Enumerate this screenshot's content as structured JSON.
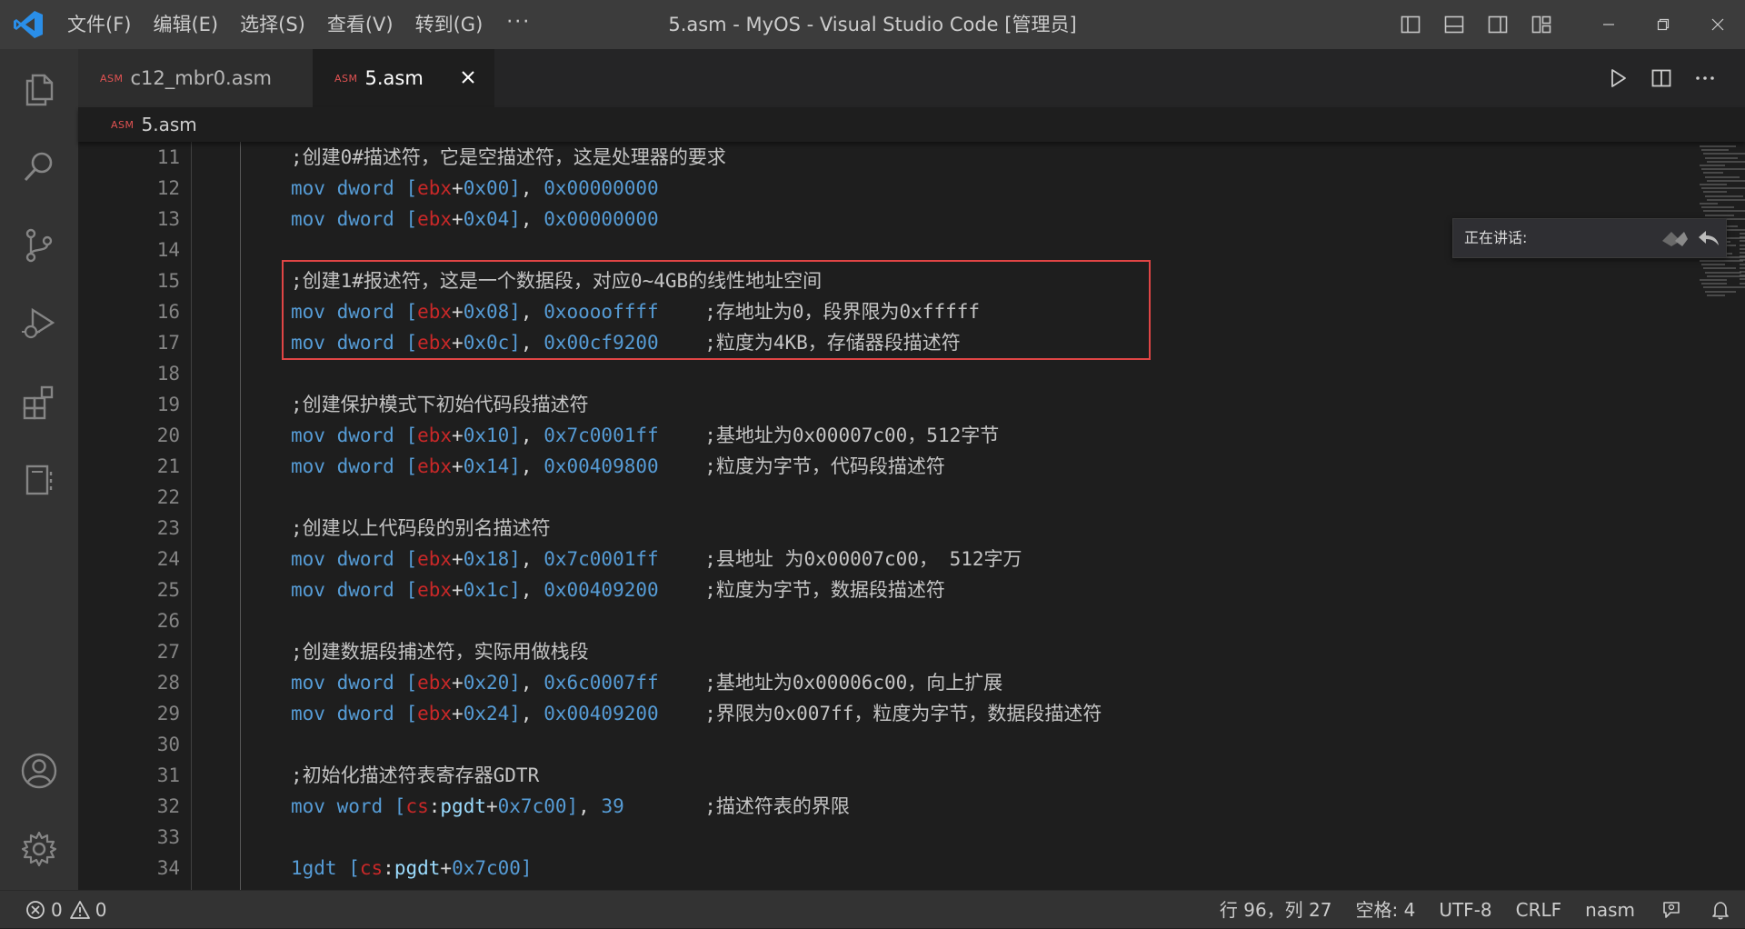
{
  "titlebar": {
    "menus": [
      "文件(F)",
      "编辑(E)",
      "选择(S)",
      "查看(V)",
      "转到(G)"
    ],
    "more": "···",
    "window_title": "5.asm - MyOS - Visual Studio Code [管理员]"
  },
  "tabs": [
    {
      "badge": "ASM",
      "label": "c12_mbr0.asm",
      "active": false
    },
    {
      "badge": "ASM",
      "label": "5.asm",
      "active": true
    }
  ],
  "breadcrumb": {
    "badge": "ASM",
    "label": "5.asm"
  },
  "speaking": {
    "label": "正在讲话:"
  },
  "editor": {
    "lines": [
      {
        "n": "11",
        "tokens": [
          [
            "cmt",
            ";创建0#描述符，它是空描述符，这是处理器的要求"
          ]
        ]
      },
      {
        "n": "12",
        "tokens": [
          [
            "kw",
            "mov dword "
          ],
          [
            "br",
            "["
          ],
          [
            "reg",
            "ebx"
          ],
          [
            "op",
            "+"
          ],
          [
            "num",
            "0x00"
          ],
          [
            "br",
            "]"
          ],
          [
            "op",
            ", "
          ],
          [
            "num",
            "0x00000000"
          ]
        ]
      },
      {
        "n": "13",
        "tokens": [
          [
            "kw",
            "mov dword "
          ],
          [
            "br",
            "["
          ],
          [
            "reg",
            "ebx"
          ],
          [
            "op",
            "+"
          ],
          [
            "num",
            "0x04"
          ],
          [
            "br",
            "]"
          ],
          [
            "op",
            ", "
          ],
          [
            "num",
            "0x00000000"
          ]
        ]
      },
      {
        "n": "14",
        "tokens": []
      },
      {
        "n": "15",
        "tokens": [
          [
            "cmt",
            ";创建1#报述符，这是一个数据段，对应0~4GB的线性地址空间"
          ]
        ]
      },
      {
        "n": "16",
        "tokens": [
          [
            "kw",
            "mov dword "
          ],
          [
            "br",
            "["
          ],
          [
            "reg",
            "ebx"
          ],
          [
            "op",
            "+"
          ],
          [
            "num",
            "0x08"
          ],
          [
            "br",
            "]"
          ],
          [
            "op",
            ", "
          ],
          [
            "num",
            "0xooooffff"
          ],
          [
            "op",
            "    "
          ],
          [
            "cmt",
            ";存地址为0，段界限为0xfffff"
          ]
        ]
      },
      {
        "n": "17",
        "tokens": [
          [
            "kw",
            "mov dword "
          ],
          [
            "br",
            "["
          ],
          [
            "reg",
            "ebx"
          ],
          [
            "op",
            "+"
          ],
          [
            "num",
            "0x0c"
          ],
          [
            "br",
            "]"
          ],
          [
            "op",
            ", "
          ],
          [
            "num",
            "0x00cf9200"
          ],
          [
            "op",
            "    "
          ],
          [
            "cmt",
            ";粒度为4KB，存储器段描述符"
          ]
        ]
      },
      {
        "n": "18",
        "tokens": []
      },
      {
        "n": "19",
        "tokens": [
          [
            "cmt",
            ";创建保护模式下初始代码段描述符"
          ]
        ]
      },
      {
        "n": "20",
        "tokens": [
          [
            "kw",
            "mov dword "
          ],
          [
            "br",
            "["
          ],
          [
            "reg",
            "ebx"
          ],
          [
            "op",
            "+"
          ],
          [
            "num",
            "0x10"
          ],
          [
            "br",
            "]"
          ],
          [
            "op",
            ", "
          ],
          [
            "num",
            "0x7c0001ff"
          ],
          [
            "op",
            "    "
          ],
          [
            "cmt",
            ";基地址为0x00007c00，512字节"
          ]
        ]
      },
      {
        "n": "21",
        "tokens": [
          [
            "kw",
            "mov dword "
          ],
          [
            "br",
            "["
          ],
          [
            "reg",
            "ebx"
          ],
          [
            "op",
            "+"
          ],
          [
            "num",
            "0x14"
          ],
          [
            "br",
            "]"
          ],
          [
            "op",
            ", "
          ],
          [
            "num",
            "0x00409800"
          ],
          [
            "op",
            "    "
          ],
          [
            "cmt",
            ";粒度为字节，代码段描述符"
          ]
        ]
      },
      {
        "n": "22",
        "tokens": []
      },
      {
        "n": "23",
        "tokens": [
          [
            "cmt",
            ";创建以上代码段的别名描述符"
          ]
        ]
      },
      {
        "n": "24",
        "tokens": [
          [
            "kw",
            "mov dword "
          ],
          [
            "br",
            "["
          ],
          [
            "reg",
            "ebx"
          ],
          [
            "op",
            "+"
          ],
          [
            "num",
            "0x18"
          ],
          [
            "br",
            "]"
          ],
          [
            "op",
            ", "
          ],
          [
            "num",
            "0x7c0001ff"
          ],
          [
            "op",
            "    "
          ],
          [
            "cmt",
            ";县地址 为0x00007c00， 512字万"
          ]
        ]
      },
      {
        "n": "25",
        "tokens": [
          [
            "kw",
            "mov dword "
          ],
          [
            "br",
            "["
          ],
          [
            "reg",
            "ebx"
          ],
          [
            "op",
            "+"
          ],
          [
            "num",
            "0x1c"
          ],
          [
            "br",
            "]"
          ],
          [
            "op",
            ", "
          ],
          [
            "num",
            "0x00409200"
          ],
          [
            "op",
            "    "
          ],
          [
            "cmt",
            ";粒度为字节，数据段描述符"
          ]
        ]
      },
      {
        "n": "26",
        "tokens": []
      },
      {
        "n": "27",
        "tokens": [
          [
            "cmt",
            ";创建数据段捕述符，实际用做栈段"
          ]
        ]
      },
      {
        "n": "28",
        "tokens": [
          [
            "kw",
            "mov dword "
          ],
          [
            "br",
            "["
          ],
          [
            "reg",
            "ebx"
          ],
          [
            "op",
            "+"
          ],
          [
            "num",
            "0x20"
          ],
          [
            "br",
            "]"
          ],
          [
            "op",
            ", "
          ],
          [
            "num",
            "0x6c0007ff"
          ],
          [
            "op",
            "    "
          ],
          [
            "cmt",
            ";基地址为0x00006c00，向上扩展"
          ]
        ]
      },
      {
        "n": "29",
        "tokens": [
          [
            "kw",
            "mov dword "
          ],
          [
            "br",
            "["
          ],
          [
            "reg",
            "ebx"
          ],
          [
            "op",
            "+"
          ],
          [
            "num",
            "0x24"
          ],
          [
            "br",
            "]"
          ],
          [
            "op",
            ", "
          ],
          [
            "num",
            "0x00409200"
          ],
          [
            "op",
            "    "
          ],
          [
            "cmt",
            ";界限为0x007ff，粒度为字节，数据段描述符"
          ]
        ]
      },
      {
        "n": "30",
        "tokens": []
      },
      {
        "n": "31",
        "tokens": [
          [
            "cmt",
            ";初始化描述符表寄存器GDTR"
          ]
        ]
      },
      {
        "n": "32",
        "tokens": [
          [
            "kw",
            "mov word "
          ],
          [
            "br",
            "["
          ],
          [
            "reg",
            "cs"
          ],
          [
            "op",
            ":"
          ],
          [
            "lbl",
            "pgdt"
          ],
          [
            "op",
            "+"
          ],
          [
            "num",
            "0x7c00"
          ],
          [
            "br",
            "]"
          ],
          [
            "op",
            ", "
          ],
          [
            "num",
            "39"
          ],
          [
            "op",
            "       "
          ],
          [
            "cmt",
            ";描述符表的界限"
          ]
        ]
      },
      {
        "n": "33",
        "tokens": []
      },
      {
        "n": "34",
        "tokens": [
          [
            "kw",
            "1gdt "
          ],
          [
            "br",
            "["
          ],
          [
            "reg",
            "cs"
          ],
          [
            "op",
            ":"
          ],
          [
            "lbl",
            "pgdt"
          ],
          [
            "op",
            "+"
          ],
          [
            "num",
            "0x7c00"
          ],
          [
            "br",
            "]"
          ]
        ]
      }
    ]
  },
  "statusbar": {
    "errors": "0",
    "warnings": "0",
    "position": "行 96，列 27",
    "spaces": "空格: 4",
    "encoding": "UTF-8",
    "eol": "CRLF",
    "language": "nasm"
  }
}
